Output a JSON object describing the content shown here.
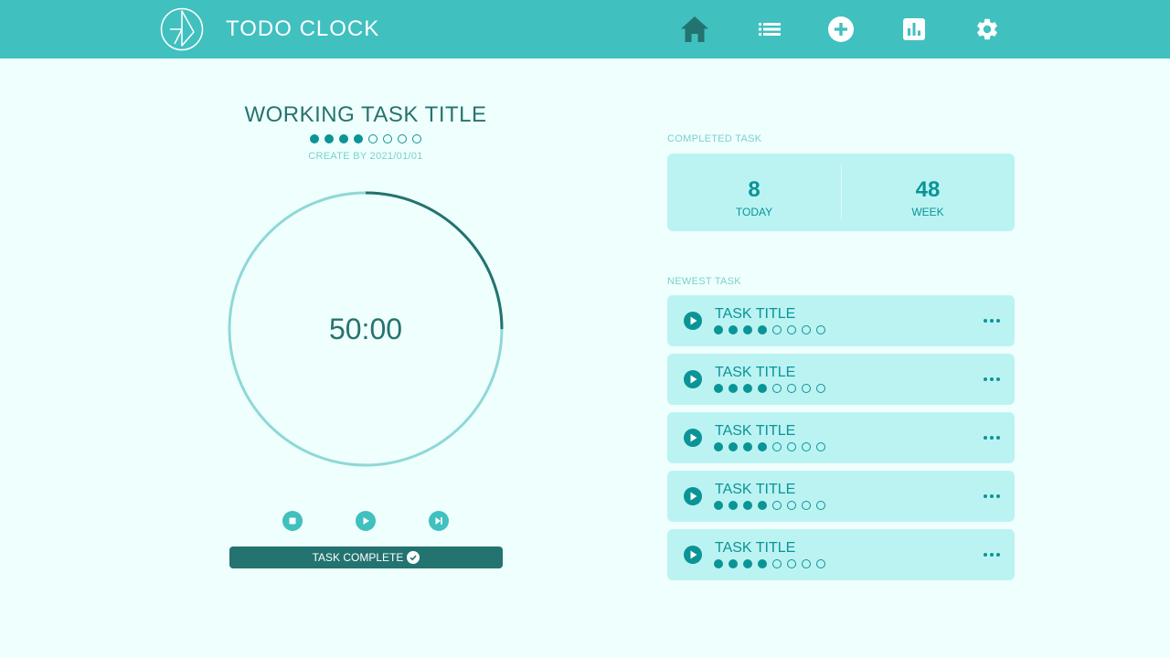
{
  "app": {
    "title": "TODO CLOCK",
    "logo_icon": "clock-logo-icon"
  },
  "nav": {
    "items": [
      {
        "name": "home",
        "icon": "home-icon"
      },
      {
        "name": "list",
        "icon": "list-icon"
      },
      {
        "name": "add",
        "icon": "add-circle-icon"
      },
      {
        "name": "stats",
        "icon": "bar-chart-icon"
      },
      {
        "name": "settings",
        "icon": "gear-icon"
      }
    ]
  },
  "current_task": {
    "title": "WORKING TASK TITLE",
    "progress_filled": 4,
    "progress_total": 8,
    "created": "CREATE BY 2021/01/01",
    "timer": "50:00",
    "timer_progress": 0.25
  },
  "controls": {
    "stop_icon": "stop-icon",
    "play_icon": "play-icon",
    "skip_icon": "skip-next-icon",
    "complete_label": "TASK COMPLETE",
    "complete_icon": "check-circle-icon"
  },
  "completed": {
    "label": "COMPLETED TASK",
    "today_value": "8",
    "today_label": "TODAY",
    "week_value": "48",
    "week_label": "WEEK"
  },
  "newest": {
    "label": "NEWEST TASK",
    "tasks": [
      {
        "title": "TASK TITLE",
        "filled": 4,
        "total": 8
      },
      {
        "title": "TASK TITLE",
        "filled": 4,
        "total": 8
      },
      {
        "title": "TASK TITLE",
        "filled": 4,
        "total": 8
      },
      {
        "title": "TASK TITLE",
        "filled": 4,
        "total": 8
      },
      {
        "title": "TASK TITLE",
        "filled": 4,
        "total": 8
      }
    ]
  },
  "colors": {
    "header": "#40c0bf",
    "background": "#effffd",
    "card": "#bbf3f3",
    "accent": "#0a9496",
    "dark": "#237370",
    "ring_track": "#8ed8d8"
  }
}
